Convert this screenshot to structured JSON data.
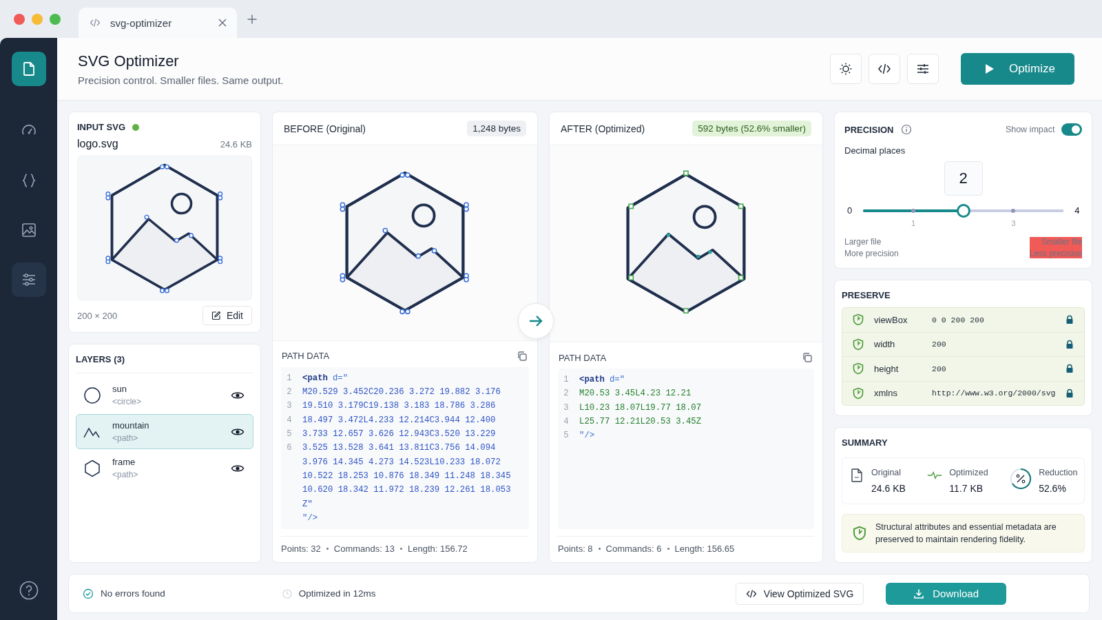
{
  "browser": {
    "tab": {
      "title": "svg-optimizer"
    }
  },
  "sidebar": {
    "items": [
      {
        "kind": "file",
        "selected": true,
        "highlighted": false
      },
      {
        "kind": "gauge",
        "selected": false,
        "highlighted": false
      },
      {
        "kind": "braces",
        "selected": false,
        "highlighted": false
      },
      {
        "kind": "image",
        "selected": false,
        "highlighted": false
      },
      {
        "kind": "sliders",
        "selected": false,
        "highlighted": true
      }
    ]
  },
  "header": {
    "title": "SVG Optimizer",
    "subtitle": "Precision control. Smaller files. Same output.",
    "primary_button": "Optimize"
  },
  "input": {
    "title": "INPUT SVG",
    "status_ok": true,
    "file_name": "logo.svg",
    "file_size": "24.6 KB",
    "dimensions": "200 × 200",
    "edit_button": "Edit"
  },
  "layers": {
    "title": "LAYERS (3)",
    "items": [
      {
        "kind": "circle",
        "name": "sun",
        "tag": "<circle>",
        "selected": false,
        "visible": true
      },
      {
        "kind": "mountain",
        "name": "mountain",
        "tag": "<path>",
        "selected": true,
        "visible": true
      },
      {
        "kind": "hexagon",
        "name": "frame",
        "tag": "<path>",
        "selected": false,
        "visible": true
      }
    ]
  },
  "before": {
    "title": "BEFORE (Original)",
    "badge": "1,248 bytes",
    "path_title": "PATH DATA",
    "lines": [
      {
        "num": "1",
        "kind": "open",
        "tag": "<path",
        "attr": "d=\""
      },
      {
        "num": "2",
        "kind": "data",
        "text": "M20.529 3.452C20.236 3.272 19.882 3.176"
      },
      {
        "num": "3",
        "kind": "data",
        "text": "19.510 3.179C19.138 3.183 18.786 3.286"
      },
      {
        "num": "4",
        "kind": "data",
        "text": "18.497 3.472L4.233 12.214C3.944 12.400"
      },
      {
        "num": "5",
        "kind": "data",
        "text": "3.733 12.657 3.626 12.943C3.520 13.229"
      },
      {
        "num": "6",
        "kind": "data",
        "text": "3.525 13.528 3.641 13.811C3.756 14.094"
      },
      {
        "kind": "data",
        "text": "3.976 14.345 4.273 14.523L10.233 18.072"
      },
      {
        "kind": "data",
        "text": "10.522 18.253 10.876 18.349 11.248 18.345"
      },
      {
        "kind": "data",
        "text": "10.620 18.342 11.972 18.239 12.261 18.053"
      },
      {
        "kind": "data",
        "text": "Z\""
      },
      {
        "kind": "close",
        "text": "\"/>"
      }
    ],
    "stats": [
      "Points: 32",
      "Commands: 13",
      "Length: 156.72"
    ]
  },
  "after": {
    "title": "AFTER (Optimized)",
    "badge": "592 bytes (52.6% smaller)",
    "path_title": "PATH DATA",
    "lines": [
      {
        "num": "1",
        "kind": "open",
        "tag": "<path",
        "attr": "d=\""
      },
      {
        "num": "2",
        "kind": "data",
        "text": "M20.53 3.45L4.23 12.21"
      },
      {
        "num": "3",
        "kind": "data",
        "text": "L10.23 18.07L19.77 18.07"
      },
      {
        "num": "4",
        "kind": "data",
        "text": "L25.77 12.21L20.53 3.45Z"
      },
      {
        "num": "5",
        "kind": "close",
        "text": "\"/>"
      }
    ],
    "stats": [
      "Points: 8",
      "Commands: 6",
      "Length: 156.65"
    ]
  },
  "precision": {
    "title": "PRECISION",
    "toggle_label": "Show impact",
    "toggle_on": true,
    "field_label": "Decimal places",
    "value": "2",
    "min_label": "0",
    "max_label": "4",
    "tick_labels": [
      "1",
      "3"
    ],
    "level": 0.5,
    "left_hint": [
      "Larger file",
      "More precision"
    ],
    "right_hint": [
      "Smaller file",
      "Less precision"
    ]
  },
  "preserve": {
    "title": "PRESERVE",
    "rows": [
      {
        "name": "viewBox",
        "value": "0 0 200 200",
        "locked": true
      },
      {
        "name": "width",
        "value": "200",
        "locked": true
      },
      {
        "name": "height",
        "value": "200",
        "locked": true
      },
      {
        "name": "xmlns",
        "value": "http://www.w3.org/2000/svg",
        "locked": true
      }
    ]
  },
  "summary": {
    "title": "SUMMARY",
    "stats": [
      {
        "kind": "file",
        "label": "Original",
        "value": "24.6 KB"
      },
      {
        "kind": "pulse",
        "label": "Optimized",
        "value": "11.7 KB"
      },
      {
        "kind": "percent",
        "label": "Reduction",
        "value": "52.6%"
      }
    ],
    "note": "Structural attributes and essential metadata are preserved to maintain rendering fidelity."
  },
  "status_bar": {
    "check": "No errors found",
    "timing": "Optimized in 12ms",
    "view_button": "View Optimized SVG",
    "download_button": "Download"
  }
}
